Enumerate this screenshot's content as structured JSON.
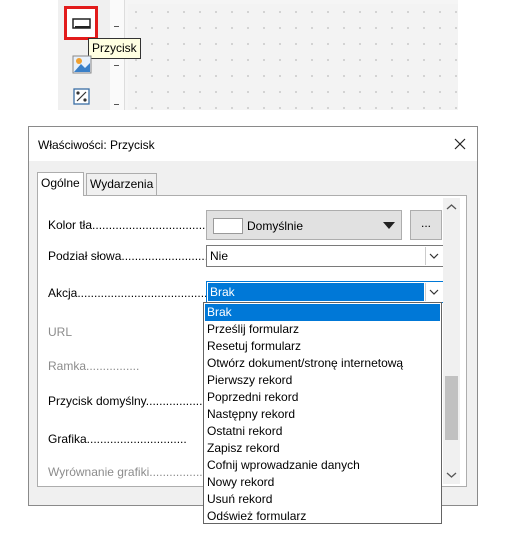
{
  "toolbar": {
    "tooltip": "Przycisk",
    "tools": [
      {
        "name": "push-button-tool-icon"
      },
      {
        "name": "image-button-tool-icon"
      },
      {
        "name": "formatted-field-tool-icon"
      }
    ]
  },
  "dialog": {
    "title": "Właściwości: Przycisk",
    "close_icon": "close-icon",
    "tabs": [
      {
        "label": "Ogólne",
        "active": true
      },
      {
        "label": "Wydarzenia",
        "active": false
      }
    ],
    "fields": {
      "kolor_tla": {
        "label": "Kolor tła....................................",
        "value": "Domyślnie",
        "more": "..."
      },
      "podzial_slowa": {
        "label": "Podział słowa...........................",
        "value": "Nie"
      },
      "akcja": {
        "label": "Akcja...........................................",
        "value": "Brak"
      },
      "url": {
        "label": "URL"
      },
      "ramka": {
        "label": "Ramka................"
      },
      "przycisk_domyslny": {
        "label": "Przycisk domyślny.................."
      },
      "grafika": {
        "label": "Grafika.............................."
      },
      "wyrownanie_grafiki": {
        "label": "Wyrównanie grafiki........................"
      }
    },
    "action_options": [
      "Brak",
      "Prześlij formularz",
      "Resetuj formularz",
      "Otwórz dokument/stronę internetową",
      "Pierwszy rekord",
      "Poprzedni rekord",
      "Następny rekord",
      "Ostatni rekord",
      "Zapisz rekord",
      "Cofnij wprowadzanie danych",
      "Nowy rekord",
      "Usuń rekord",
      "Odśwież formularz"
    ],
    "selected_action": "Brak"
  },
  "colors": {
    "highlight": "#0078d7",
    "active_tool_border": "#e21b1b",
    "tooltip_bg": "#ffffe1"
  }
}
